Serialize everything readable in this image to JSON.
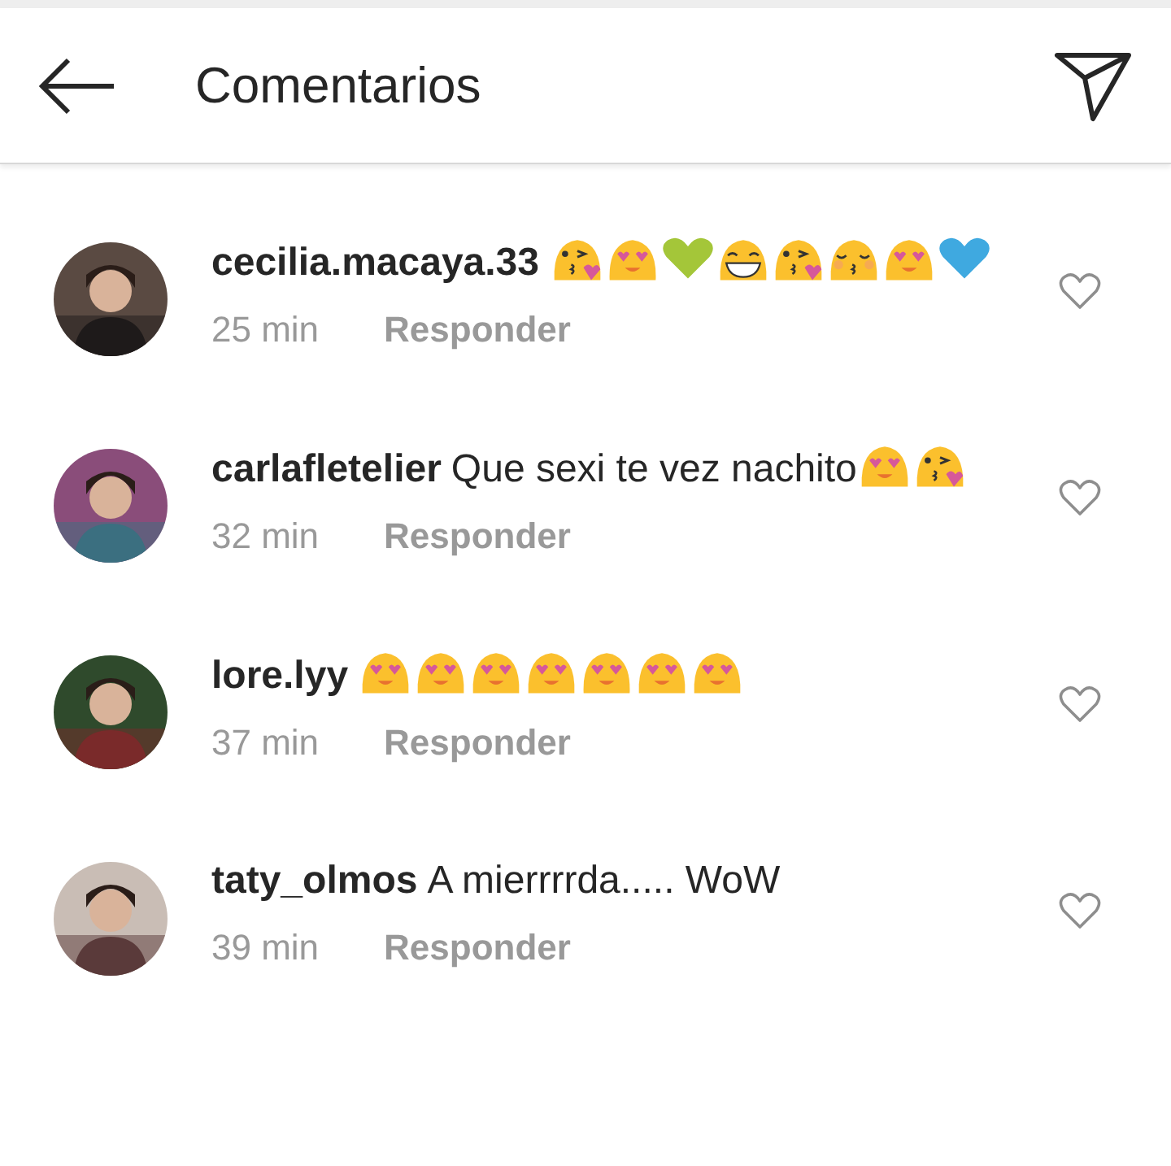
{
  "header": {
    "title": "Comentarios"
  },
  "comments": [
    {
      "user": "cecilia.macaya.33",
      "parts": [
        {
          "kind": "kiss-wink"
        },
        {
          "kind": "heart-eyes"
        },
        {
          "kind": "heart",
          "color": "#a4c639"
        },
        {
          "kind": "grin"
        },
        {
          "kind": "kiss-wink"
        },
        {
          "kind": "kiss-closed"
        },
        {
          "kind": "heart-eyes"
        },
        {
          "kind": "heart",
          "color": "#3fa9e0"
        }
      ],
      "time": "25 min",
      "reply": "Responder"
    },
    {
      "user": "carlafletelier",
      "parts": [
        {
          "kind": "text",
          "text": "Que sexi te vez nachito"
        },
        {
          "kind": "heart-eyes"
        },
        {
          "kind": "kiss-wink"
        }
      ],
      "time": "32 min",
      "reply": "Responder"
    },
    {
      "user": "lore.lyy",
      "parts": [
        {
          "kind": "heart-eyes"
        },
        {
          "kind": "heart-eyes"
        },
        {
          "kind": "heart-eyes"
        },
        {
          "kind": "heart-eyes"
        },
        {
          "kind": "heart-eyes"
        },
        {
          "kind": "heart-eyes"
        },
        {
          "kind": "heart-eyes"
        }
      ],
      "time": "37 min",
      "reply": "Responder"
    },
    {
      "user": "taty_olmos",
      "parts": [
        {
          "kind": "text",
          "text": "A mierrrrda..... WoW"
        }
      ],
      "time": "39 min",
      "reply": "Responder"
    }
  ]
}
